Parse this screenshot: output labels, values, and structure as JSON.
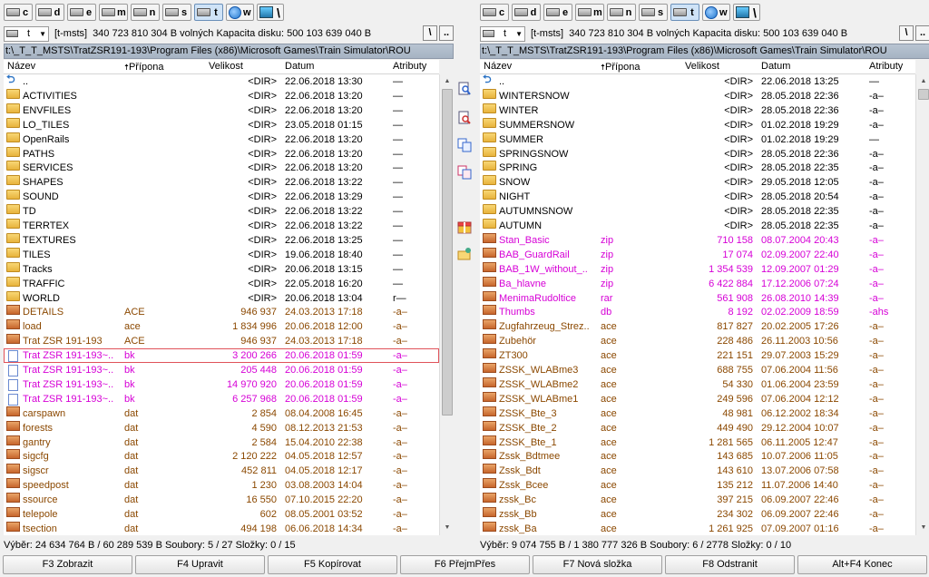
{
  "drives": [
    {
      "letter": "c",
      "active": false,
      "type": "hd"
    },
    {
      "letter": "d",
      "active": false,
      "type": "hd"
    },
    {
      "letter": "e",
      "active": false,
      "type": "hd"
    },
    {
      "letter": "m",
      "active": false,
      "type": "hd"
    },
    {
      "letter": "n",
      "active": false,
      "type": "hd"
    },
    {
      "letter": "s",
      "active": false,
      "type": "hd"
    },
    {
      "letter": "t",
      "active": true,
      "type": "hd"
    },
    {
      "letter": "w",
      "active": false,
      "type": "net"
    },
    {
      "letter": "\\",
      "active": false,
      "type": "mon"
    }
  ],
  "colors": {
    "dir": "#000000",
    "ace": "#8b4800",
    "archive": "#d600d6",
    "bk": "#d600d6",
    "dat": "#8b4800",
    "db": "#d600d6"
  },
  "headers": {
    "name": "Název",
    "ext": "Přípona",
    "size": "Velikost",
    "date": "Datum",
    "attr": "Atributy"
  },
  "left": {
    "drive": "t",
    "label": "[t-msts]",
    "info": "340 723 810 304 B volných  Kapacita disku: 500 103 639 040 B",
    "root_label": "\\",
    "up_label": "..",
    "path": "t:\\_T_T_MSTS\\TratZSR191-193\\Program Files (x86)\\Microsoft Games\\Train Simulator\\ROU",
    "sort_col": "ext",
    "files": [
      {
        "icon": "up",
        "name": "..",
        "ext": "",
        "size": "<DIR>",
        "date": "22.06.2018 13:30",
        "attr": "—",
        "kind": "dir"
      },
      {
        "icon": "folder",
        "name": "ACTIVITIES",
        "ext": "",
        "size": "<DIR>",
        "date": "22.06.2018 13:20",
        "attr": "—",
        "kind": "dir"
      },
      {
        "icon": "folder",
        "name": "ENVFILES",
        "ext": "",
        "size": "<DIR>",
        "date": "22.06.2018 13:20",
        "attr": "—",
        "kind": "dir"
      },
      {
        "icon": "folder",
        "name": "LO_TILES",
        "ext": "",
        "size": "<DIR>",
        "date": "23.05.2018 01:15",
        "attr": "—",
        "kind": "dir"
      },
      {
        "icon": "folder",
        "name": "OpenRails",
        "ext": "",
        "size": "<DIR>",
        "date": "22.06.2018 13:20",
        "attr": "—",
        "kind": "dir"
      },
      {
        "icon": "folder",
        "name": "PATHS",
        "ext": "",
        "size": "<DIR>",
        "date": "22.06.2018 13:20",
        "attr": "—",
        "kind": "dir"
      },
      {
        "icon": "folder",
        "name": "SERVICES",
        "ext": "",
        "size": "<DIR>",
        "date": "22.06.2018 13:20",
        "attr": "—",
        "kind": "dir"
      },
      {
        "icon": "folder",
        "name": "SHAPES",
        "ext": "",
        "size": "<DIR>",
        "date": "22.06.2018 13:22",
        "attr": "—",
        "kind": "dir"
      },
      {
        "icon": "folder",
        "name": "SOUND",
        "ext": "",
        "size": "<DIR>",
        "date": "22.06.2018 13:29",
        "attr": "—",
        "kind": "dir"
      },
      {
        "icon": "folder",
        "name": "TD",
        "ext": "",
        "size": "<DIR>",
        "date": "22.06.2018 13:22",
        "attr": "—",
        "kind": "dir"
      },
      {
        "icon": "folder",
        "name": "TERRTEX",
        "ext": "",
        "size": "<DIR>",
        "date": "22.06.2018 13:22",
        "attr": "—",
        "kind": "dir"
      },
      {
        "icon": "folder",
        "name": "TEXTURES",
        "ext": "",
        "size": "<DIR>",
        "date": "22.06.2018 13:25",
        "attr": "—",
        "kind": "dir"
      },
      {
        "icon": "folder",
        "name": "TILES",
        "ext": "",
        "size": "<DIR>",
        "date": "19.06.2018 18:40",
        "attr": "—",
        "kind": "dir"
      },
      {
        "icon": "folder",
        "name": "Tracks",
        "ext": "",
        "size": "<DIR>",
        "date": "20.06.2018 13:15",
        "attr": "—",
        "kind": "dir"
      },
      {
        "icon": "folder",
        "name": "TRAFFIC",
        "ext": "",
        "size": "<DIR>",
        "date": "22.05.2018 16:20",
        "attr": "—",
        "kind": "dir"
      },
      {
        "icon": "folder",
        "name": "WORLD",
        "ext": "",
        "size": "<DIR>",
        "date": "20.06.2018 13:04",
        "attr": "r—",
        "kind": "dir"
      },
      {
        "icon": "file",
        "name": "DETAILS",
        "ext": "ACE",
        "size": "946 937",
        "date": "24.03.2013 17:18",
        "attr": "-a–",
        "kind": "ace"
      },
      {
        "icon": "file",
        "name": "load",
        "ext": "ace",
        "size": "1 834 996",
        "date": "20.06.2018 12:00",
        "attr": "-a–",
        "kind": "ace"
      },
      {
        "icon": "file",
        "name": "Trat ZSR 191-193",
        "ext": "ACE",
        "size": "946 937",
        "date": "24.03.2013 17:18",
        "attr": "-a–",
        "kind": "ace"
      },
      {
        "icon": "blank",
        "name": "Trat ZSR 191-193~..",
        "ext": "bk",
        "size": "3 200 266",
        "date": "20.06.2018 01:59",
        "attr": "-a–",
        "kind": "bk",
        "selected": true
      },
      {
        "icon": "blank",
        "name": "Trat ZSR 191-193~..",
        "ext": "bk",
        "size": "205 448",
        "date": "20.06.2018 01:59",
        "attr": "-a–",
        "kind": "bk"
      },
      {
        "icon": "blank",
        "name": "Trat ZSR 191-193~..",
        "ext": "bk",
        "size": "14 970 920",
        "date": "20.06.2018 01:59",
        "attr": "-a–",
        "kind": "bk"
      },
      {
        "icon": "blank",
        "name": "Trat ZSR 191-193~..",
        "ext": "bk",
        "size": "6 257 968",
        "date": "20.06.2018 01:59",
        "attr": "-a–",
        "kind": "bk"
      },
      {
        "icon": "file",
        "name": "carspawn",
        "ext": "dat",
        "size": "2 854",
        "date": "08.04.2008 16:45",
        "attr": "-a–",
        "kind": "dat"
      },
      {
        "icon": "file",
        "name": "forests",
        "ext": "dat",
        "size": "4 590",
        "date": "08.12.2013 21:53",
        "attr": "-a–",
        "kind": "dat"
      },
      {
        "icon": "file",
        "name": "gantry",
        "ext": "dat",
        "size": "2 584",
        "date": "15.04.2010 22:38",
        "attr": "-a–",
        "kind": "dat"
      },
      {
        "icon": "file",
        "name": "sigcfg",
        "ext": "dat",
        "size": "2 120 222",
        "date": "04.05.2018 12:57",
        "attr": "-a–",
        "kind": "dat"
      },
      {
        "icon": "file",
        "name": "sigscr",
        "ext": "dat",
        "size": "452 811",
        "date": "04.05.2018 12:17",
        "attr": "-a–",
        "kind": "dat"
      },
      {
        "icon": "file",
        "name": "speedpost",
        "ext": "dat",
        "size": "1 230",
        "date": "03.08.2003 14:04",
        "attr": "-a–",
        "kind": "dat"
      },
      {
        "icon": "file",
        "name": "ssource",
        "ext": "dat",
        "size": "16 550",
        "date": "07.10.2015 22:20",
        "attr": "-a–",
        "kind": "dat"
      },
      {
        "icon": "file",
        "name": "telepole",
        "ext": "dat",
        "size": "602",
        "date": "08.05.2001 03:52",
        "attr": "-a–",
        "kind": "dat"
      },
      {
        "icon": "file",
        "name": "tsection",
        "ext": "dat",
        "size": "494 198",
        "date": "06.06.2018 14:34",
        "attr": "-a–",
        "kind": "dat"
      }
    ],
    "status": "Výběr: 24 634 764 B / 60 289 539 B  Soubory: 5 / 27  Složky: 0 / 15"
  },
  "right": {
    "drive": "t",
    "label": "[t-msts]",
    "info": "340 723 810 304 B volných  Kapacita disku: 500 103 639 040 B",
    "root_label": "\\",
    "up_label": "..",
    "path": "t:\\_T_T_MSTS\\TratZSR191-193\\Program Files (x86)\\Microsoft Games\\Train Simulator\\ROU",
    "sort_col": "ext",
    "files": [
      {
        "icon": "up",
        "name": "..",
        "ext": "",
        "size": "<DIR>",
        "date": "22.06.2018 13:25",
        "attr": "—",
        "kind": "dir"
      },
      {
        "icon": "folder",
        "name": "WINTERSNOW",
        "ext": "",
        "size": "<DIR>",
        "date": "28.05.2018 22:36",
        "attr": "-a–",
        "kind": "dir"
      },
      {
        "icon": "folder",
        "name": "WINTER",
        "ext": "",
        "size": "<DIR>",
        "date": "28.05.2018 22:36",
        "attr": "-a–",
        "kind": "dir"
      },
      {
        "icon": "folder",
        "name": "SUMMERSNOW",
        "ext": "",
        "size": "<DIR>",
        "date": "01.02.2018 19:29",
        "attr": "-a–",
        "kind": "dir"
      },
      {
        "icon": "folder",
        "name": "SUMMER",
        "ext": "",
        "size": "<DIR>",
        "date": "01.02.2018 19:29",
        "attr": "—",
        "kind": "dir"
      },
      {
        "icon": "folder",
        "name": "SPRINGSNOW",
        "ext": "",
        "size": "<DIR>",
        "date": "28.05.2018 22:36",
        "attr": "-a–",
        "kind": "dir"
      },
      {
        "icon": "folder",
        "name": "SPRING",
        "ext": "",
        "size": "<DIR>",
        "date": "28.05.2018 22:35",
        "attr": "-a–",
        "kind": "dir"
      },
      {
        "icon": "folder",
        "name": "SNOW",
        "ext": "",
        "size": "<DIR>",
        "date": "29.05.2018 12:05",
        "attr": "-a–",
        "kind": "dir"
      },
      {
        "icon": "folder",
        "name": "NIGHT",
        "ext": "",
        "size": "<DIR>",
        "date": "28.05.2018 20:54",
        "attr": "-a–",
        "kind": "dir"
      },
      {
        "icon": "folder",
        "name": "AUTUMNSNOW",
        "ext": "",
        "size": "<DIR>",
        "date": "28.05.2018 22:35",
        "attr": "-a–",
        "kind": "dir"
      },
      {
        "icon": "folder",
        "name": "AUTUMN",
        "ext": "",
        "size": "<DIR>",
        "date": "28.05.2018 22:35",
        "attr": "-a–",
        "kind": "dir"
      },
      {
        "icon": "file",
        "name": "Stan_Basic",
        "ext": "zip",
        "size": "710 158",
        "date": "08.07.2004 20:43",
        "attr": "-a–",
        "kind": "archive"
      },
      {
        "icon": "file",
        "name": "BAB_GuardRail",
        "ext": "zip",
        "size": "17 074",
        "date": "02.09.2007 22:40",
        "attr": "-a–",
        "kind": "archive"
      },
      {
        "icon": "file",
        "name": "BAB_1W_without_..",
        "ext": "zip",
        "size": "1 354 539",
        "date": "12.09.2007 01:29",
        "attr": "-a–",
        "kind": "archive"
      },
      {
        "icon": "file",
        "name": "Ba_hlavne",
        "ext": "zip",
        "size": "6 422 884",
        "date": "17.12.2006 07:24",
        "attr": "-a–",
        "kind": "archive"
      },
      {
        "icon": "file",
        "name": "MenimaRudoltice",
        "ext": "rar",
        "size": "561 908",
        "date": "26.08.2010 14:39",
        "attr": "-a–",
        "kind": "archive"
      },
      {
        "icon": "file",
        "name": "Thumbs",
        "ext": "db",
        "size": "8 192",
        "date": "02.02.2009 18:59",
        "attr": "-ahs",
        "kind": "db"
      },
      {
        "icon": "file",
        "name": "Zugfahrzeug_Strez..",
        "ext": "ace",
        "size": "817 827",
        "date": "20.02.2005 17:26",
        "attr": "-a–",
        "kind": "ace"
      },
      {
        "icon": "file",
        "name": "Zubehör",
        "ext": "ace",
        "size": "228 486",
        "date": "26.11.2003 10:56",
        "attr": "-a–",
        "kind": "ace"
      },
      {
        "icon": "file",
        "name": "ZT300",
        "ext": "ace",
        "size": "221 151",
        "date": "29.07.2003 15:29",
        "attr": "-a–",
        "kind": "ace"
      },
      {
        "icon": "file",
        "name": "ZSSK_WLABme3",
        "ext": "ace",
        "size": "688 755",
        "date": "07.06.2004 11:56",
        "attr": "-a–",
        "kind": "ace"
      },
      {
        "icon": "file",
        "name": "ZSSK_WLABme2",
        "ext": "ace",
        "size": "54 330",
        "date": "01.06.2004 23:59",
        "attr": "-a–",
        "kind": "ace"
      },
      {
        "icon": "file",
        "name": "ZSSK_WLABme1",
        "ext": "ace",
        "size": "249 596",
        "date": "07.06.2004 12:12",
        "attr": "-a–",
        "kind": "ace"
      },
      {
        "icon": "file",
        "name": "ZSSK_Bte_3",
        "ext": "ace",
        "size": "48 981",
        "date": "06.12.2002 18:34",
        "attr": "-a–",
        "kind": "ace"
      },
      {
        "icon": "file",
        "name": "ZSSK_Bte_2",
        "ext": "ace",
        "size": "449 490",
        "date": "29.12.2004 10:07",
        "attr": "-a–",
        "kind": "ace"
      },
      {
        "icon": "file",
        "name": "ZSSK_Bte_1",
        "ext": "ace",
        "size": "1 281 565",
        "date": "06.11.2005 12:47",
        "attr": "-a–",
        "kind": "ace"
      },
      {
        "icon": "file",
        "name": "Zssk_Bdtmee",
        "ext": "ace",
        "size": "143 685",
        "date": "10.07.2006 11:05",
        "attr": "-a–",
        "kind": "ace"
      },
      {
        "icon": "file",
        "name": "Zssk_Bdt",
        "ext": "ace",
        "size": "143 610",
        "date": "13.07.2006 07:58",
        "attr": "-a–",
        "kind": "ace"
      },
      {
        "icon": "file",
        "name": "Zssk_Bcee",
        "ext": "ace",
        "size": "135 212",
        "date": "11.07.2006 14:40",
        "attr": "-a–",
        "kind": "ace"
      },
      {
        "icon": "file",
        "name": "zssk_Bc",
        "ext": "ace",
        "size": "397 215",
        "date": "06.09.2007 22:46",
        "attr": "-a–",
        "kind": "ace"
      },
      {
        "icon": "file",
        "name": "zssk_Bb",
        "ext": "ace",
        "size": "234 302",
        "date": "06.09.2007 22:46",
        "attr": "-a–",
        "kind": "ace"
      },
      {
        "icon": "file",
        "name": "zssk_Ba",
        "ext": "ace",
        "size": "1 261 925",
        "date": "07.09.2007 01:16",
        "attr": "-a–",
        "kind": "ace"
      }
    ],
    "status": "Výběr: 9 074 755 B / 1 380 777 326 B  Soubory: 6 / 2778  Složky: 0 / 10"
  },
  "middle_icons": [
    "search-icon",
    "find-file-icon",
    "copy-icon",
    "move-icon",
    "package-icon",
    "new-folder-icon"
  ],
  "fkeys": [
    "F3 Zobrazit",
    "F4 Upravit",
    "F5 Kopírovat",
    "F6 PřejmPřes",
    "F7 Nová složka",
    "F8 Odstranit",
    "Alt+F4 Konec"
  ]
}
